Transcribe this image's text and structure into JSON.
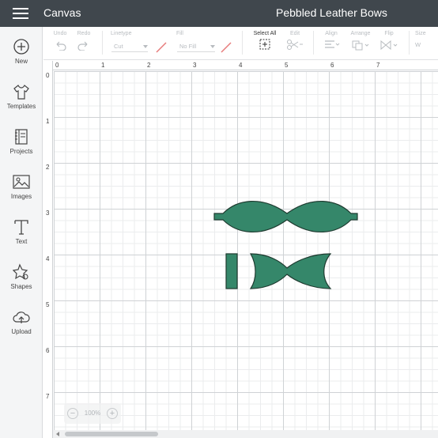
{
  "header": {
    "app_title": "Canvas",
    "project_title": "Pebbled Leather Bows"
  },
  "sidebar": {
    "items": [
      {
        "label": "New",
        "icon": "plus-circle-icon"
      },
      {
        "label": "Templates",
        "icon": "tshirt-icon"
      },
      {
        "label": "Projects",
        "icon": "notebook-icon"
      },
      {
        "label": "Images",
        "icon": "image-icon"
      },
      {
        "label": "Text",
        "icon": "text-t-icon"
      },
      {
        "label": "Shapes",
        "icon": "shapes-icon"
      },
      {
        "label": "Upload",
        "icon": "cloud-upload-icon"
      }
    ]
  },
  "toolbar": {
    "undo": "Undo",
    "redo": "Redo",
    "linetype_label": "Linetype",
    "linetype_value": "Cut",
    "fill_label": "Fill",
    "fill_value": "No Fill",
    "select_all": "Select All",
    "edit": "Edit",
    "align": "Align",
    "arrange": "Arrange",
    "flip": "Flip",
    "size_label": "Size",
    "size_w": "W"
  },
  "rulers": {
    "top": [
      "0",
      "1",
      "2",
      "3",
      "4",
      "5",
      "6",
      "7"
    ],
    "left": [
      "0",
      "1",
      "2",
      "3",
      "4",
      "5",
      "6",
      "7"
    ]
  },
  "zoom": {
    "value": "100%",
    "minus": "−",
    "plus": "+"
  },
  "colors": {
    "bow_fill": "#35876a",
    "bow_stroke": "#1f3b30",
    "topbar": "#40474d",
    "grid_major": "#cfd2d5",
    "grid_minor": "#ebecee"
  }
}
